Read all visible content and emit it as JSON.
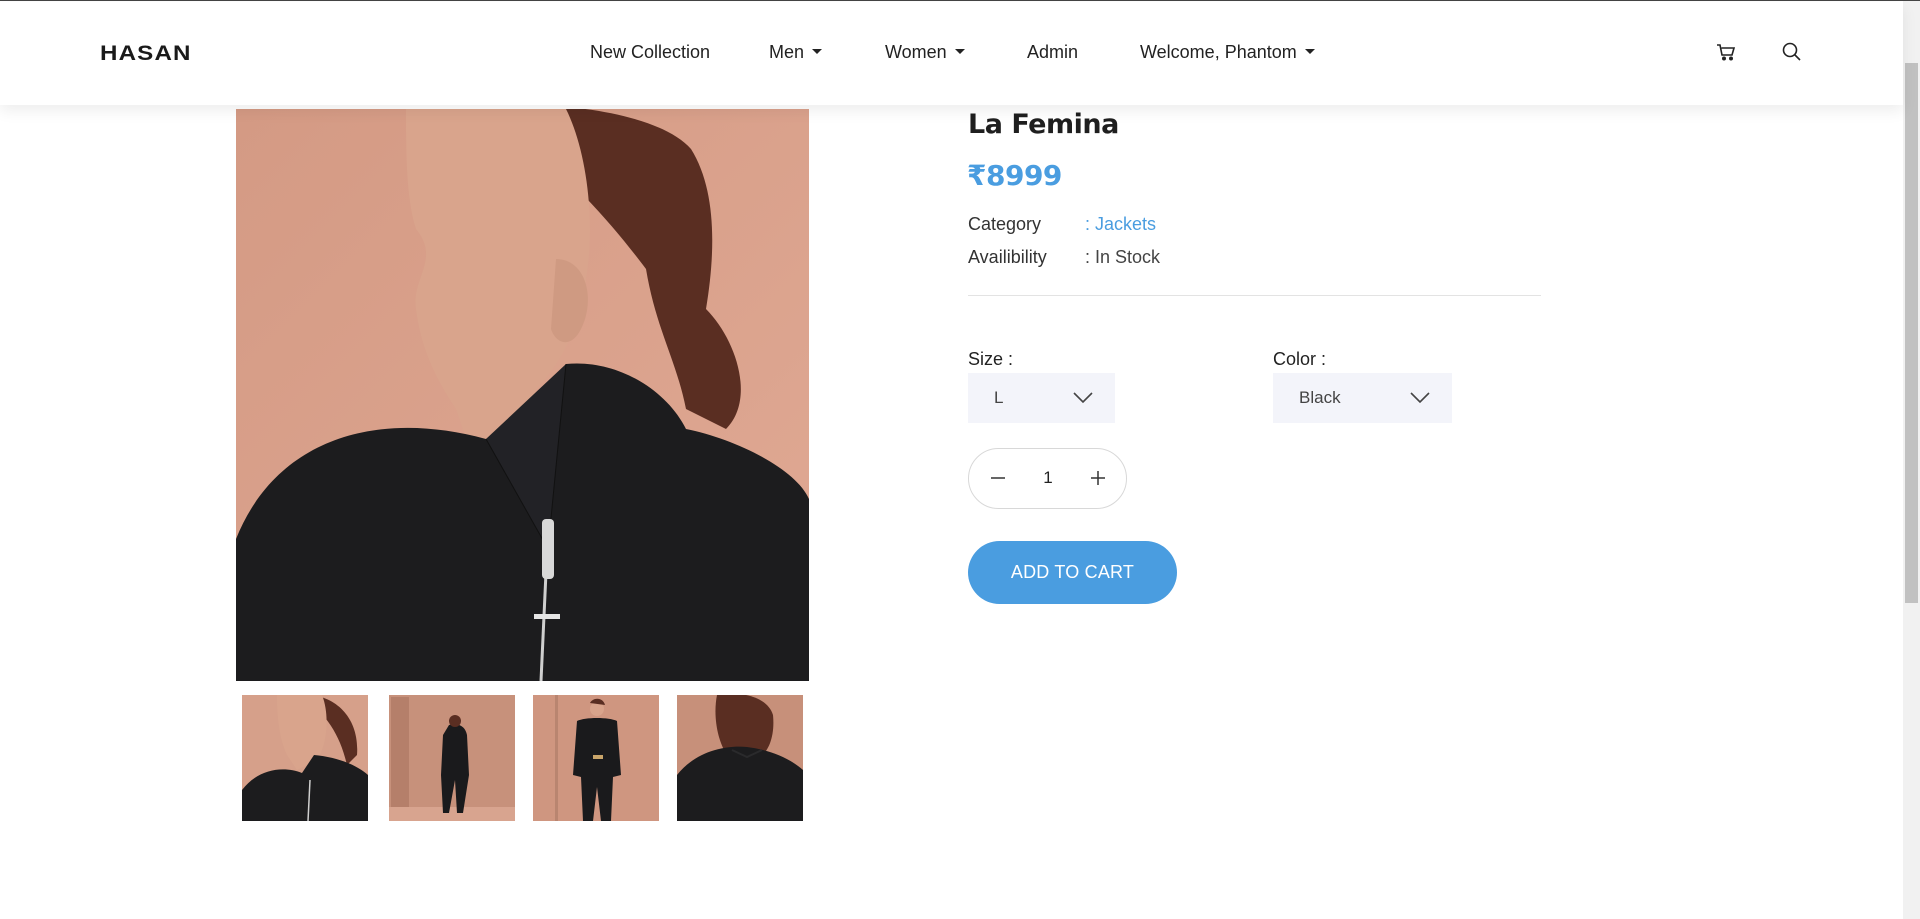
{
  "header": {
    "logo": "HASAN",
    "nav": [
      {
        "label": "New Collection"
      },
      {
        "label": "Men"
      },
      {
        "label": "Women"
      },
      {
        "label": "Admin"
      },
      {
        "label": "Welcome, Phantom"
      }
    ],
    "icons": [
      "cart-icon",
      "search-icon"
    ]
  },
  "product": {
    "title": "La Femina",
    "price": "₹8999",
    "category_label": "Category",
    "category_value": ": Jackets",
    "availability_label": "Availibility",
    "availability_value": ": In Stock",
    "size_label": "Size :",
    "size_value": "L",
    "color_label": "Color :",
    "color_value": "Black",
    "quantity": "1",
    "add_to_cart": "ADD TO CART"
  },
  "colors": {
    "accent": "#4a9de0",
    "select_bg": "#f3f4fa",
    "photo_bg": "#d9a08a",
    "jacket": "#1c1c1e"
  }
}
